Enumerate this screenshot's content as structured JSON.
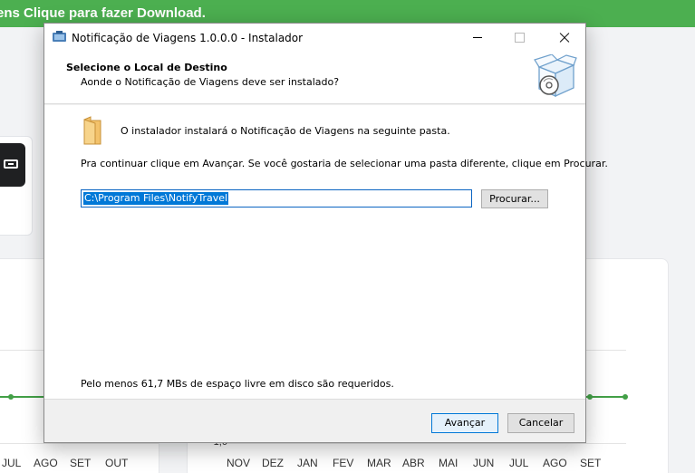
{
  "background_page": {
    "banner_text": "ens Clique para fazer Download.",
    "left_chart_months": [
      "JUL",
      "AGO",
      "SET",
      "OUT"
    ],
    "right_chart_months": [
      "NOV",
      "DEZ",
      "JAN",
      "FEV",
      "MAR",
      "ABR",
      "MAI",
      "JUN",
      "JUL",
      "AGO",
      "SET"
    ],
    "right_chart_ytick": "-1,0",
    "line_color": "#43a047",
    "banner_color": "#4caf50"
  },
  "dialog": {
    "title": "Notificação de Viagens 1.0.0.0 - Instalador",
    "title_icon": "installer-app-icon",
    "controls": {
      "minimize": "minimize-icon",
      "maximize": "maximize-icon",
      "close": "close-icon"
    },
    "header": {
      "heading": "Selecione o Local de Destino",
      "subheading": "Aonde o Notificação de Viagens deve ser instalado?",
      "icon": "software-box-cd-icon"
    },
    "body": {
      "folder_icon": "folder-icon",
      "info_text": "O instalador instalará o Notificação de Viagens na seguinte pasta.",
      "continue_text": "Pra continuar clique em Avançar. Se você gostaria de selecionar uma pasta diferente, clique em Procurar.",
      "path_value": "C:\\Program Files\\NotifyTravel",
      "browse_label": "Procurar...",
      "space_text": "Pelo menos 61,7 MBs de espaço livre em disco são requeridos."
    },
    "footer": {
      "next_label": "Avançar",
      "cancel_label": "Cancelar"
    }
  }
}
